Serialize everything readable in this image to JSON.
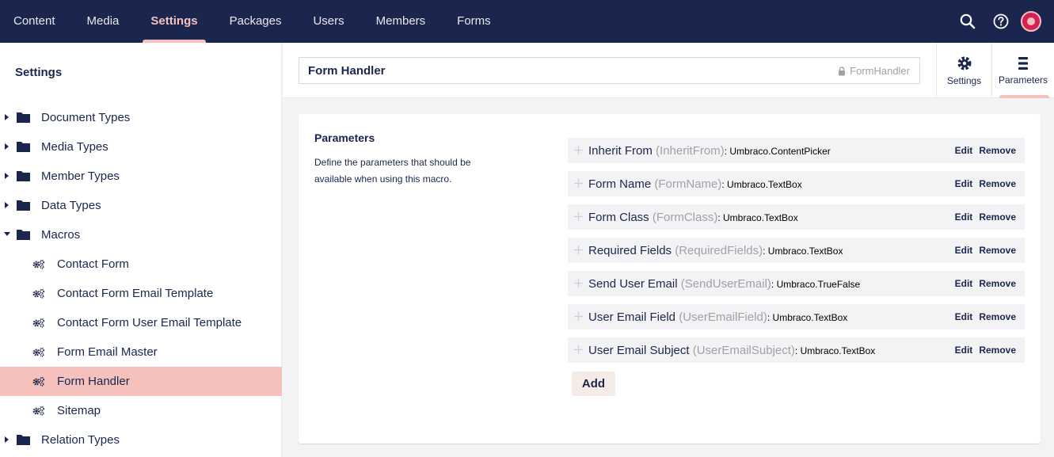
{
  "nav": {
    "items": [
      {
        "label": "Content"
      },
      {
        "label": "Media"
      },
      {
        "label": "Settings",
        "active": true
      },
      {
        "label": "Packages"
      },
      {
        "label": "Users"
      },
      {
        "label": "Members"
      },
      {
        "label": "Forms"
      }
    ],
    "tools": {
      "search_icon": "search-icon",
      "help_icon": "help-icon",
      "avatar": "user-avatar"
    }
  },
  "sidebar": {
    "title": "Settings",
    "items": [
      {
        "label": "Document Types",
        "type": "folder",
        "expanded": false
      },
      {
        "label": "Media Types",
        "type": "folder",
        "expanded": false
      },
      {
        "label": "Member Types",
        "type": "folder",
        "expanded": false
      },
      {
        "label": "Data Types",
        "type": "folder",
        "expanded": false
      },
      {
        "label": "Macros",
        "type": "folder",
        "expanded": true
      },
      {
        "label": "Contact Form",
        "type": "macro"
      },
      {
        "label": "Contact Form Email Template",
        "type": "macro"
      },
      {
        "label": "Contact Form User Email Template",
        "type": "macro"
      },
      {
        "label": "Form Email Master",
        "type": "macro"
      },
      {
        "label": "Form Handler",
        "type": "macro",
        "selected": true
      },
      {
        "label": "Sitemap",
        "type": "macro"
      },
      {
        "label": "Relation Types",
        "type": "folder",
        "expanded": false
      }
    ]
  },
  "editor": {
    "name": "Form Handler",
    "alias": "FormHandler",
    "apps": {
      "settings": "Settings",
      "parameters": "Parameters"
    }
  },
  "panel": {
    "title": "Parameters",
    "description": "Define the parameters that should be available when using this macro.",
    "params": [
      {
        "name": "Inherit From",
        "alias": "(InheritFrom)",
        "type": ": Umbraco.ContentPicker"
      },
      {
        "name": "Form Name",
        "alias": "(FormName)",
        "type": ": Umbraco.TextBox"
      },
      {
        "name": "Form Class",
        "alias": "(FormClass)",
        "type": ": Umbraco.TextBox"
      },
      {
        "name": "Required Fields",
        "alias": "(RequiredFields)",
        "type": ": Umbraco.TextBox"
      },
      {
        "name": "Send User Email",
        "alias": "(SendUserEmail)",
        "type": ": Umbraco.TrueFalse"
      },
      {
        "name": "User Email Field",
        "alias": "(UserEmailField)",
        "type": ": Umbraco.TextBox"
      },
      {
        "name": "User Email Subject",
        "alias": "(UserEmailSubject)",
        "type": ": Umbraco.TextBox"
      }
    ],
    "edit_label": "Edit",
    "remove_label": "Remove",
    "add_label": "Add"
  },
  "colors": {
    "topbar": "#1b264f",
    "accent": "#f5c1bc",
    "text": "#1b264f"
  }
}
